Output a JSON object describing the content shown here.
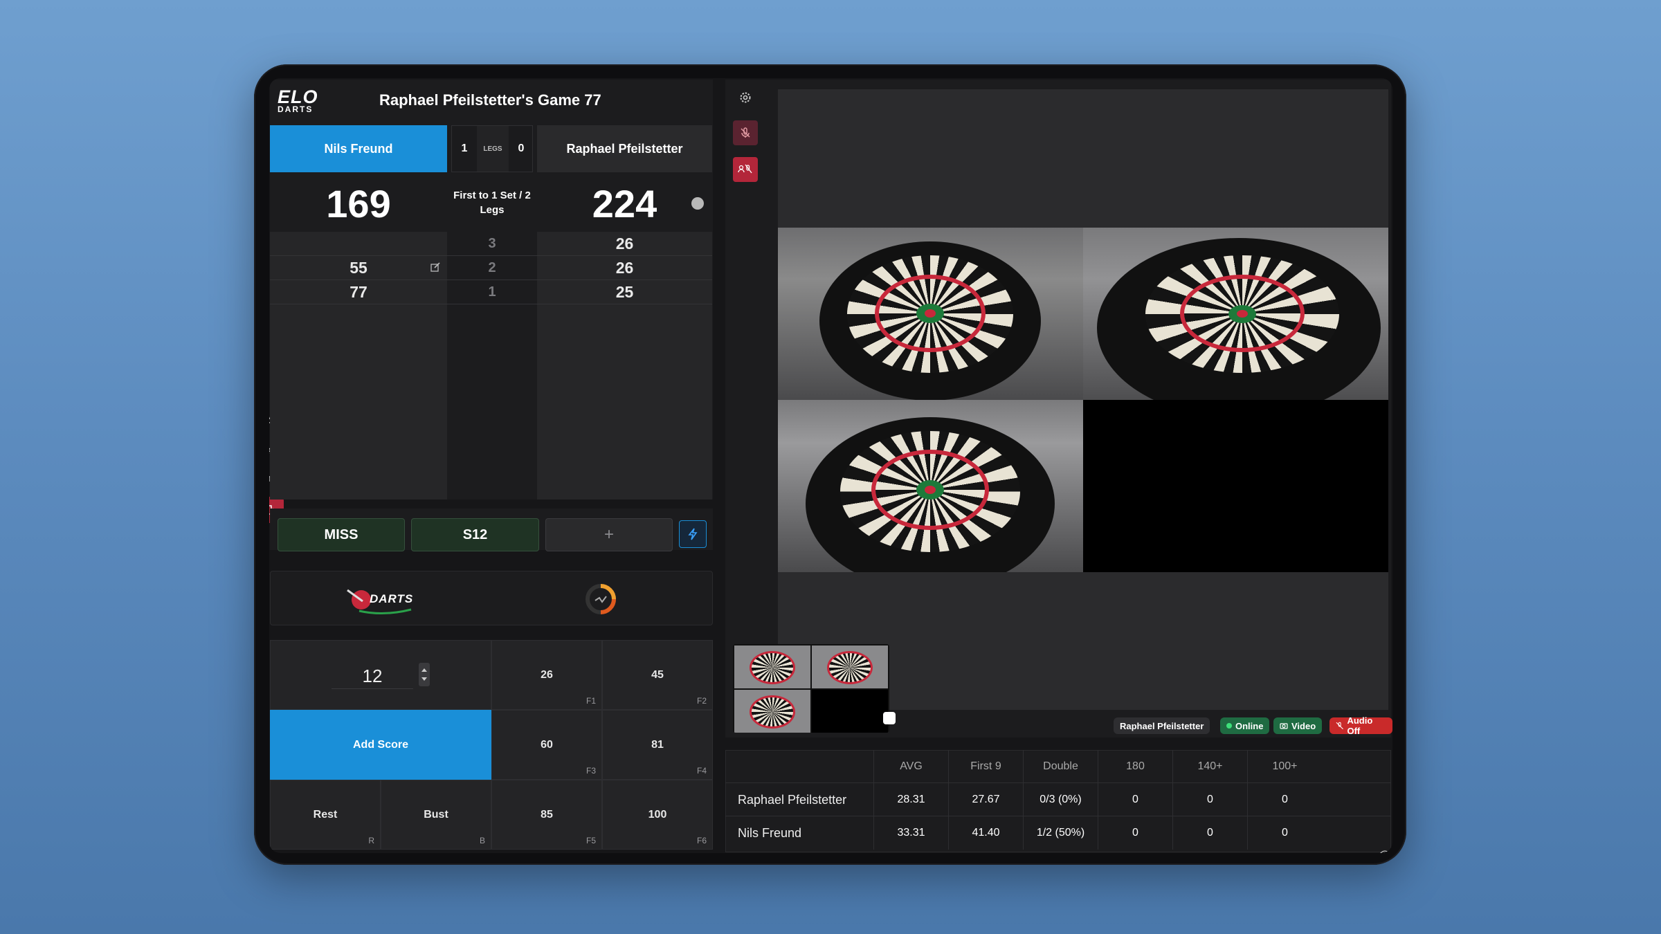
{
  "header": {
    "logo_top": "ELO",
    "logo_bottom": "DARTS",
    "title": "Raphael Pfeilstetter's Game 77"
  },
  "players": {
    "left": {
      "name": "Nils Freund",
      "score": "169",
      "history": [
        "",
        "55",
        "77"
      ]
    },
    "right": {
      "name": "Raphael Pfeilstetter",
      "score": "224",
      "history": [
        "26",
        "26",
        "25"
      ]
    }
  },
  "legs": {
    "left": "1",
    "label": "LEGS",
    "right": "0"
  },
  "format": "First to 1 Set / 2 Legs",
  "rounds": [
    "3",
    "2",
    "1"
  ],
  "quick_actions": {
    "miss": "MISS",
    "s12": "S12",
    "add": "+"
  },
  "sponsors": {
    "darts_logo_text": "DARTS"
  },
  "input": {
    "value": "12",
    "add_score": "Add Score",
    "rest": "Rest",
    "rest_key": "R",
    "bust": "Bust",
    "bust_key": "B",
    "presets": [
      {
        "value": "26",
        "key": "F1"
      },
      {
        "value": "45",
        "key": "F2"
      },
      {
        "value": "60",
        "key": "F3"
      },
      {
        "value": "81",
        "key": "F4"
      },
      {
        "value": "85",
        "key": "F5"
      },
      {
        "value": "100",
        "key": "F6"
      }
    ]
  },
  "video_status": {
    "player": "Raphael Pfeilstetter",
    "online": "Online",
    "video": "Video",
    "audio": "Audio Off"
  },
  "stats": {
    "headers": [
      "AVG",
      "First 9",
      "Double",
      "180",
      "140+",
      "100+"
    ],
    "rows": [
      {
        "name": "Raphael Pfeilstetter",
        "values": [
          "28.31",
          "27.67",
          "0/3 (0%)",
          "0",
          "0",
          "0"
        ]
      },
      {
        "name": "Nils Freund",
        "values": [
          "33.31",
          "41.40",
          "1/2 (50%)",
          "0",
          "0",
          "0"
        ]
      }
    ]
  },
  "colors": {
    "accent_blue": "#1a8fd8",
    "active_red": "#b3263a",
    "online_green": "#1f8a4c",
    "audio_red": "#c92a2a"
  }
}
